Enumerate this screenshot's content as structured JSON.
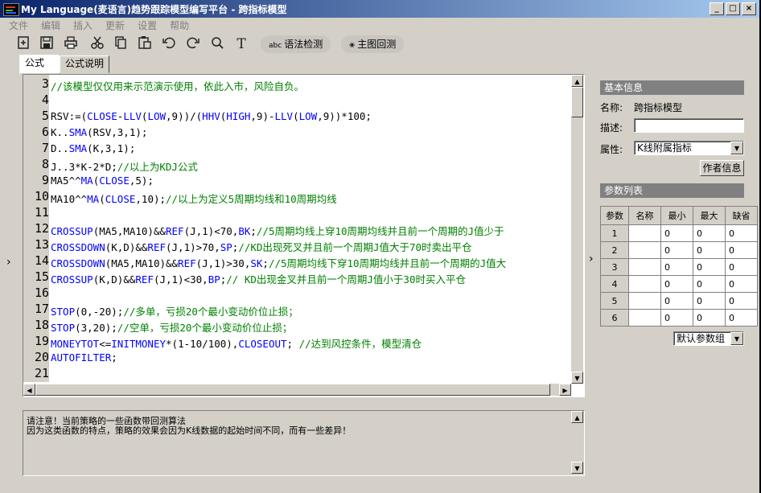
{
  "window": {
    "title": "My Language(麦语言)趋势跟踪模型编写平台 - 跨指标模型",
    "buttons": {
      "minimize": "_",
      "maximize": "□",
      "close": "×"
    }
  },
  "menu": [
    "文件",
    "编辑",
    "插入",
    "更新",
    "设置",
    "帮助"
  ],
  "toolbar": {
    "syntax_check": "语法检测",
    "backtest": "主图回测"
  },
  "tabs": [
    "公式",
    "公式说明"
  ],
  "editor": {
    "line_numbers": [
      "3",
      "4",
      "5",
      "6",
      "7",
      "8",
      "9",
      "10",
      "11",
      "12",
      "13",
      "14",
      "15",
      "16",
      "17",
      "18",
      "19",
      "20",
      "21"
    ],
    "lines": [
      [
        {
          "t": "//该模型仅仅用来示范演示使用，依此入市，风险自负。",
          "c": "cm"
        }
      ],
      [],
      [
        {
          "t": "RSV:=(",
          "c": ""
        },
        {
          "t": "CLOSE",
          "c": "k"
        },
        {
          "t": "-",
          "c": ""
        },
        {
          "t": "LLV",
          "c": "k"
        },
        {
          "t": "(",
          "c": ""
        },
        {
          "t": "LOW",
          "c": "k"
        },
        {
          "t": ",9))/(",
          "c": ""
        },
        {
          "t": "HHV",
          "c": "k"
        },
        {
          "t": "(",
          "c": ""
        },
        {
          "t": "HIGH",
          "c": "k"
        },
        {
          "t": ",9)-",
          "c": ""
        },
        {
          "t": "LLV",
          "c": "k"
        },
        {
          "t": "(",
          "c": ""
        },
        {
          "t": "LOW",
          "c": "k"
        },
        {
          "t": ",9))*100;",
          "c": ""
        }
      ],
      [
        {
          "t": "K..",
          "c": ""
        },
        {
          "t": "SMA",
          "c": "k"
        },
        {
          "t": "(RSV,3,1);",
          "c": ""
        }
      ],
      [
        {
          "t": "D..",
          "c": ""
        },
        {
          "t": "SMA",
          "c": "k"
        },
        {
          "t": "(K,3,1);",
          "c": ""
        }
      ],
      [
        {
          "t": "J..3*K-2*D;",
          "c": ""
        },
        {
          "t": "//以上为KDJ公式",
          "c": "cm"
        }
      ],
      [
        {
          "t": "MA5^^",
          "c": ""
        },
        {
          "t": "MA",
          "c": "k"
        },
        {
          "t": "(",
          "c": ""
        },
        {
          "t": "CLOSE",
          "c": "k"
        },
        {
          "t": ",5);",
          "c": ""
        }
      ],
      [
        {
          "t": "MA10^^",
          "c": ""
        },
        {
          "t": "MA",
          "c": "k"
        },
        {
          "t": "(",
          "c": ""
        },
        {
          "t": "CLOSE",
          "c": "k"
        },
        {
          "t": ",10);",
          "c": ""
        },
        {
          "t": "//以上为定义5周期均线和10周期均线",
          "c": "cm"
        }
      ],
      [],
      [
        {
          "t": "CROSSUP",
          "c": "k"
        },
        {
          "t": "(MA5,MA10)&&",
          "c": ""
        },
        {
          "t": "REF",
          "c": "k"
        },
        {
          "t": "(J,1)<70,",
          "c": ""
        },
        {
          "t": "BK",
          "c": "k"
        },
        {
          "t": ";",
          "c": ""
        },
        {
          "t": "//5周期均线上穿10周期均线并且前一个周期的J值少于",
          "c": "cm"
        }
      ],
      [
        {
          "t": "CROSSDOWN",
          "c": "k"
        },
        {
          "t": "(K,D)&&",
          "c": ""
        },
        {
          "t": "REF",
          "c": "k"
        },
        {
          "t": "(J,1)>70,",
          "c": ""
        },
        {
          "t": "SP",
          "c": "k"
        },
        {
          "t": ";",
          "c": ""
        },
        {
          "t": "//KD出现死叉并且前一个周期J值大于70时卖出平仓",
          "c": "cm"
        }
      ],
      [
        {
          "t": "CROSSDOWN",
          "c": "k"
        },
        {
          "t": "(MA5,MA10)&&",
          "c": ""
        },
        {
          "t": "REF",
          "c": "k"
        },
        {
          "t": "(J,1)>30,",
          "c": ""
        },
        {
          "t": "SK",
          "c": "k"
        },
        {
          "t": ";",
          "c": ""
        },
        {
          "t": "//5周期均线下穿10周期均线并且前一个周期的J值大",
          "c": "cm"
        }
      ],
      [
        {
          "t": "CROSSUP",
          "c": "k"
        },
        {
          "t": "(K,D)&&",
          "c": ""
        },
        {
          "t": "REF",
          "c": "k"
        },
        {
          "t": "(J,1)<30,",
          "c": ""
        },
        {
          "t": "BP",
          "c": "k"
        },
        {
          "t": ";",
          "c": ""
        },
        {
          "t": "// KD出现金叉并且前一个周期J值小于30时买入平仓",
          "c": "cm"
        }
      ],
      [],
      [
        {
          "t": "STOP",
          "c": "k"
        },
        {
          "t": "(0,-20);",
          "c": ""
        },
        {
          "t": "//多单，亏损20个最小变动价位止损；",
          "c": "cm"
        }
      ],
      [
        {
          "t": "STOP",
          "c": "k"
        },
        {
          "t": "(3,20);",
          "c": ""
        },
        {
          "t": "//空单，亏损20个最小变动价位止损；",
          "c": "cm"
        }
      ],
      [
        {
          "t": "MONEYTOT",
          "c": "k"
        },
        {
          "t": "<=",
          "c": ""
        },
        {
          "t": "INITMONEY",
          "c": "k"
        },
        {
          "t": "*(1-10/100),",
          "c": ""
        },
        {
          "t": "CLOSEOUT",
          "c": "k"
        },
        {
          "t": "; ",
          "c": ""
        },
        {
          "t": "//达到风控条件，模型清仓",
          "c": "cm"
        }
      ],
      [
        {
          "t": "AUTOFILTER",
          "c": "k"
        },
        {
          "t": ";",
          "c": ""
        }
      ],
      []
    ]
  },
  "messages": [
    "请注意！当前策略的一些函数带回测算法",
    "因为这类函数的特点，策略的效果会因为K线数据的起始时间不同，而有一些差异！"
  ],
  "info_panel": {
    "header": "基本信息",
    "name_label": "名称:",
    "name_value": "跨指标模型",
    "desc_label": "描述:",
    "desc_value": "",
    "attr_label": "属性:",
    "attr_value": "K线附属指标",
    "author_button": "作者信息"
  },
  "param_panel": {
    "header": "参数列表",
    "columns": [
      "参数",
      "名称",
      "最小",
      "最大",
      "缺省"
    ],
    "rows": [
      {
        "idx": "1",
        "name": "",
        "min": "0",
        "max": "0",
        "def": "0"
      },
      {
        "idx": "2",
        "name": "",
        "min": "0",
        "max": "0",
        "def": "0"
      },
      {
        "idx": "3",
        "name": "",
        "min": "0",
        "max": "0",
        "def": "0"
      },
      {
        "idx": "4",
        "name": "",
        "min": "0",
        "max": "0",
        "def": "0"
      },
      {
        "idx": "5",
        "name": "",
        "min": "0",
        "max": "0",
        "def": "0"
      },
      {
        "idx": "6",
        "name": "",
        "min": "0",
        "max": "0",
        "def": "0"
      }
    ],
    "default_group": "默认参数组"
  }
}
